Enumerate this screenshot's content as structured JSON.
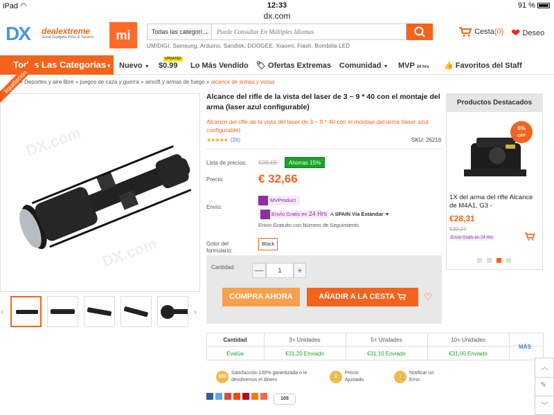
{
  "status": {
    "device": "iPad",
    "time": "12:33",
    "battery": "91 %",
    "url": "dx.com"
  },
  "header": {
    "logo_dx": "DX",
    "logo_text": "dealextreme",
    "logo_tagline": "Great Gadgets,Price & Service",
    "mi_logo": "mi",
    "search_category": "Todas las categorí...",
    "search_placeholder": "Puede Consultar En Múltiples Idiomas",
    "tags": "UMIDIGI,  Samsung,  Arduino,  Sandisk,  DOOGEE,  Xiaomi,  Flash,  Bombilla LED",
    "cart_label": "Cesta",
    "cart_count": "(0)",
    "wish_label": "Deseo"
  },
  "nav": {
    "all_categories": "Todas Las Categorías",
    "items": [
      "Nuevo",
      "$0.99",
      "Lo Más Vendido",
      "Ofertas Extremas",
      "Comunidad",
      "MVP",
      "Favoritos del Staff"
    ],
    "updated_badge": "UPDATED",
    "hrs_badge": "24 hrs"
  },
  "breadcrumb": {
    "root": "DX",
    "items": [
      "Deportes y aire libre",
      "juegos de caza y guerra",
      "airsoft y armas de fuego"
    ],
    "current": "alcance de armas y vistas"
  },
  "product": {
    "ribbon": "liquidación",
    "watermark": "DX.com",
    "title": "Alcance del rifle de la vista del laser de 3 ~ 9 * 40 con el montaje del arma (laser azul configurable)",
    "subtitle": "Alcance del rifle de la vista del laser de 3 ~ 9 * 40 con el montaje del arma (laser azul configurable)",
    "stars": "★★★★★",
    "reviews": "(26)",
    "sku": "SKU:  26216",
    "list_price_label": "Lista de precios:",
    "old_price": "€38,65",
    "save_text": "Ahorras  15%",
    "price_label": "Precio:",
    "price": "€ 32,66",
    "shipping_label": "Envío:",
    "mvp_label": "MVProduct",
    "free_tag_a": "Envío Gratis en",
    "free_tag_b": "24 Hrs",
    "ship_to": "A",
    "ship_method": "SPAIN Vía Estándar",
    "tracking": "Envío Gratuito con Número de Seguimiento",
    "color_label": "Color del formulario:",
    "color_value": "Black",
    "qty_label": "Cantidad:",
    "qty_value": "1",
    "minus": "—",
    "plus": "+",
    "buy_now": "COMPRA AHORA",
    "add_cart": "AÑADIR A LA CESTA"
  },
  "tiers": {
    "header": [
      "Cantidad",
      "3+ Unidades",
      "5+ Unidades",
      "10+ Unidades"
    ],
    "row": [
      "Evalúa",
      "€31,20 Enviado",
      "€31,10 Enviado",
      "€31,00 Enviado"
    ],
    "more": "MÁS"
  },
  "guarantees": [
    {
      "icon": "100",
      "text": "Satisfacción 100% garantizada o le devolvemos el dinero"
    },
    {
      "icon": "$",
      "text": "Precio Ajustado"
    },
    {
      "icon": "!",
      "text": "Notificar un Error"
    }
  ],
  "share_count": "105",
  "featured": {
    "heading": "Productos Destacados",
    "discount": "6%",
    "discount_off": "OFF",
    "name": "1X del arma del rifle Alcance de M4A1, G3 -",
    "price": "€28,31",
    "old_price": "€30,27",
    "ship_tag": "Envío Gratis en 24 Hrs",
    "page_dots": 4,
    "active_dot": 3
  },
  "colors": {
    "accent": "#f5621c",
    "save_green": "#1aa329",
    "mvp_purple": "#8e2ea0",
    "link_blue": "#3b7dd8"
  }
}
